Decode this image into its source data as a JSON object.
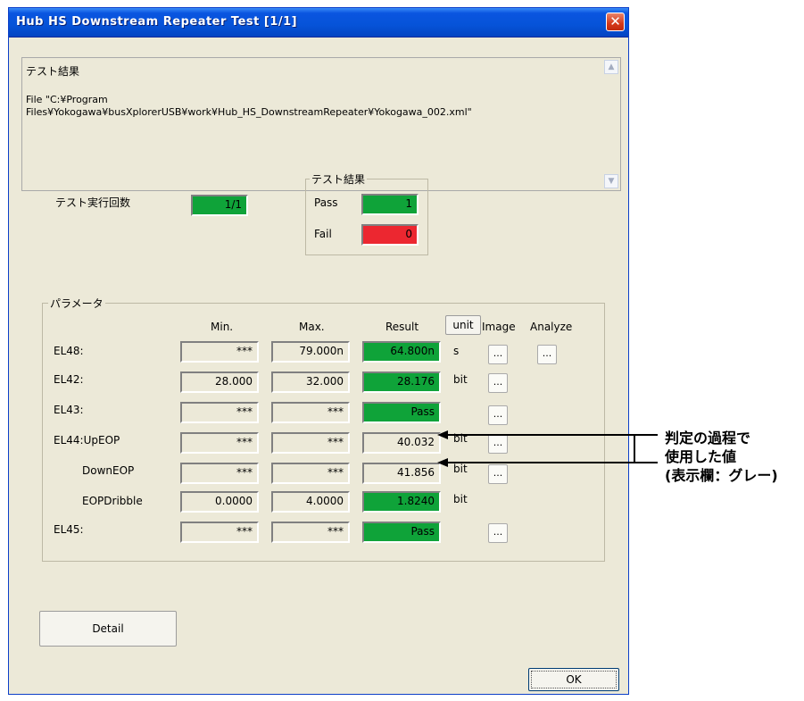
{
  "window": {
    "title": "Hub HS Downstream Repeater Test [1/1]",
    "close_glyph": "✕"
  },
  "log": {
    "heading": "テスト結果",
    "file_line1": "File \"C:¥Program",
    "file_line2": "Files¥Yokogawa¥busXplorerUSB¥work¥Hub_HS_DownstreamRepeater¥Yokogawa_002.xml\"",
    "scroll_up_icon": "chevron-up-icon",
    "scroll_down_icon": "chevron-down-icon"
  },
  "summary": {
    "run_count_label": "テスト実行回数",
    "run_count_value": "1/1",
    "result_group_title": "テスト結果",
    "pass_label": "Pass",
    "pass_value": "1",
    "fail_label": "Fail",
    "fail_value": "0"
  },
  "params": {
    "group_title": "パラメータ",
    "col_min": "Min.",
    "col_max": "Max.",
    "col_result": "Result",
    "unit_button": "unit",
    "col_image": "Image",
    "col_analyze": "Analyze",
    "dots": "...",
    "rows": [
      {
        "label": "EL48:",
        "min": "***",
        "max": "79.000n",
        "result": "64.800n",
        "unit": "s"
      },
      {
        "label": "EL42:",
        "min": "28.000",
        "max": "32.000",
        "result": "28.176",
        "unit": "bit"
      },
      {
        "label": "EL43:",
        "min": "***",
        "max": "***",
        "result": "Pass",
        "unit": ""
      },
      {
        "label": "EL44:UpEOP",
        "min": "***",
        "max": "***",
        "result": "40.032",
        "unit": "bit"
      },
      {
        "label": "DownEOP",
        "min": "***",
        "max": "***",
        "result": "41.856",
        "unit": "bit"
      },
      {
        "label": "EOPDribble",
        "min": "0.0000",
        "max": "4.0000",
        "result": "1.8240",
        "unit": "bit"
      },
      {
        "label": "EL45:",
        "min": "***",
        "max": "***",
        "result": "Pass",
        "unit": ""
      }
    ]
  },
  "buttons": {
    "detail": "Detail",
    "ok": "OK"
  },
  "annotation": {
    "line1": "判定の過程で",
    "line2": "使用した値",
    "line3": "(表示欄：グレー)"
  },
  "colors": {
    "pass_green": "#0fa339",
    "fail_red": "#ec2730",
    "gray_field": "#ece9d8"
  }
}
